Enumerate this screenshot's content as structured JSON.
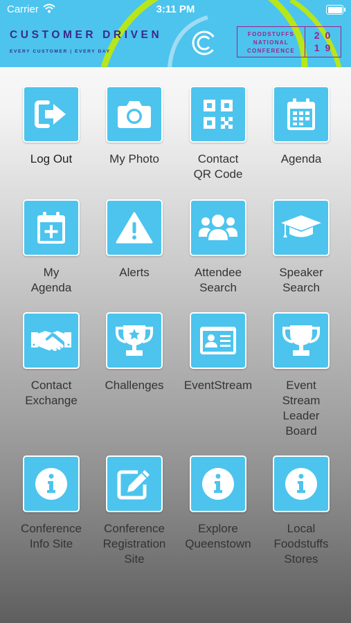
{
  "status_bar": {
    "carrier": "Carrier",
    "time": "3:11 PM"
  },
  "header": {
    "brand_title": "CUSTOMER DRIVEN",
    "brand_subtitle": "EVERY CUSTOMER | EVERY DAY",
    "conference_line1": "FOODSTUFFS",
    "conference_line2": "NATIONAL",
    "conference_line3": "CONFERENCE",
    "year_top": "20",
    "year_bottom": "19"
  },
  "menu": [
    {
      "label": "Log Out",
      "icon": "logout-icon"
    },
    {
      "label": "My Photo",
      "icon": "camera-icon"
    },
    {
      "label": "Contact\nQR Code",
      "icon": "qr-code-icon"
    },
    {
      "label": "Agenda",
      "icon": "calendar-icon"
    },
    {
      "label": "My\nAgenda",
      "icon": "calendar-add-icon"
    },
    {
      "label": "Alerts",
      "icon": "warning-icon"
    },
    {
      "label": "Attendee\nSearch",
      "icon": "users-icon"
    },
    {
      "label": "Speaker\nSearch",
      "icon": "graduation-cap-icon"
    },
    {
      "label": "Contact\nExchange",
      "icon": "handshake-icon"
    },
    {
      "label": "Challenges",
      "icon": "trophy-star-icon"
    },
    {
      "label": "EventStream",
      "icon": "id-card-icon"
    },
    {
      "label": "Event\nStream\nLeader\nBoard",
      "icon": "trophy-icon"
    },
    {
      "label": "Conference\nInfo Site",
      "icon": "info-icon"
    },
    {
      "label": "Conference\nRegistration\nSite",
      "icon": "edit-icon"
    },
    {
      "label": "Explore\nQueenstown",
      "icon": "info-icon"
    },
    {
      "label": "Local\nFoodstuffs\nStores",
      "icon": "info-icon"
    }
  ],
  "colors": {
    "accent": "#4cc4ee",
    "brand_purple": "#3b2a8c",
    "conference_magenta": "#a0208a",
    "arc_green": "#b7e61a"
  }
}
